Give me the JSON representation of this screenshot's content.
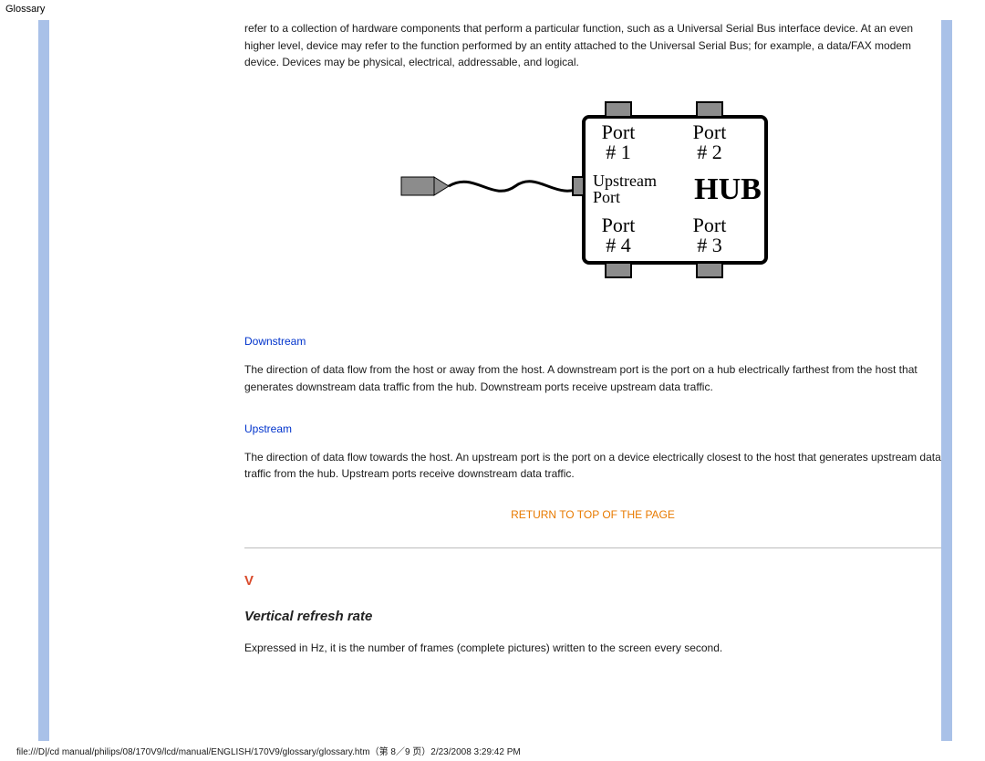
{
  "page": {
    "title": "Glossary",
    "footer": "file:///D|/cd manual/philips/08/170V9/lcd/manual/ENGLISH/170V9/glossary/glossary.htm（第 8／9 页）2/23/2008 3:29:42 PM"
  },
  "content": {
    "intro_para": "refer to a collection of hardware components that perform a particular function, such as a Universal Serial Bus interface device. At an even higher level, device may refer to the function performed by an entity attached to the Universal Serial Bus; for example, a data/FAX modem device. Devices may be physical, electrical, addressable, and logical.",
    "terms": {
      "downstream": {
        "label": "Downstream",
        "body": "The direction of data flow from the host or away from the host. A downstream port is the port on a hub electrically farthest from the host that generates downstream data traffic from the hub. Downstream ports receive upstream data traffic."
      },
      "upstream": {
        "label": "Upstream",
        "body": "The direction of data flow towards the host. An upstream port is the port on a device electrically closest to the host that generates upstream data traffic from the hub. Upstream ports receive downstream data traffic."
      }
    },
    "return_link": "RETURN TO TOP OF THE PAGE",
    "section_v": {
      "letter": "V",
      "heading": "Vertical refresh rate",
      "body": "Expressed in Hz, it is the number of frames (complete pictures) written to the screen every second."
    }
  },
  "diagram": {
    "port1": "Port",
    "port1_num": "# 1",
    "port2": "Port",
    "port2_num": "# 2",
    "upstream_label1": "Upstream",
    "upstream_label2": "Port",
    "hub": "HUB",
    "port4": "Port",
    "port4_num": "# 4",
    "port3": "Port",
    "port3_num": "# 3"
  }
}
